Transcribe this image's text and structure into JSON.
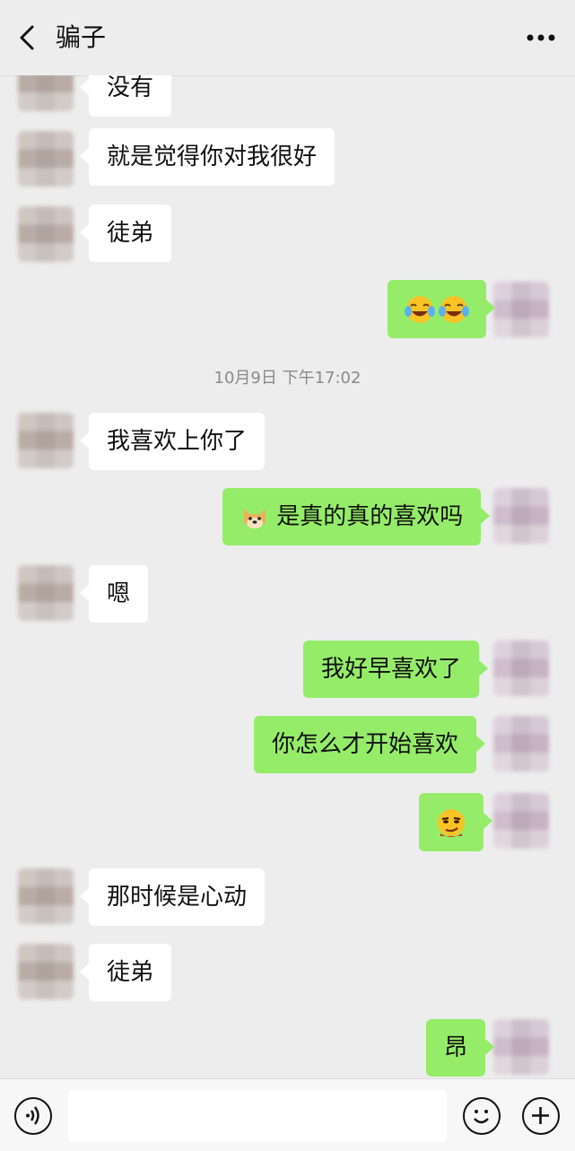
{
  "header": {
    "title": "骗子"
  },
  "timestamp": "10月9日 下午17:02",
  "messages": [
    {
      "text": "没有"
    },
    {
      "text": "就是觉得你对我很好"
    },
    {
      "text": "徒弟"
    },
    {
      "text": ""
    },
    {
      "text": "我喜欢上你了"
    },
    {
      "text": "是真的真的喜欢吗"
    },
    {
      "text": "嗯"
    },
    {
      "text": "我好早喜欢了"
    },
    {
      "text": "你怎么才开始喜欢"
    },
    {
      "text": ""
    },
    {
      "text": "那时候是心动"
    },
    {
      "text": "徒弟"
    },
    {
      "text": "昂"
    }
  ],
  "icons": {
    "back": "chevron-left-icon",
    "more": "more-dots-icon",
    "laugh": "laughing-tears-emoji-icon",
    "dog": "doge-emoji-icon",
    "smirk": "smirk-emoji-icon",
    "voice": "voice-icon",
    "emoji": "emoji-icon",
    "plus": "plus-icon"
  }
}
